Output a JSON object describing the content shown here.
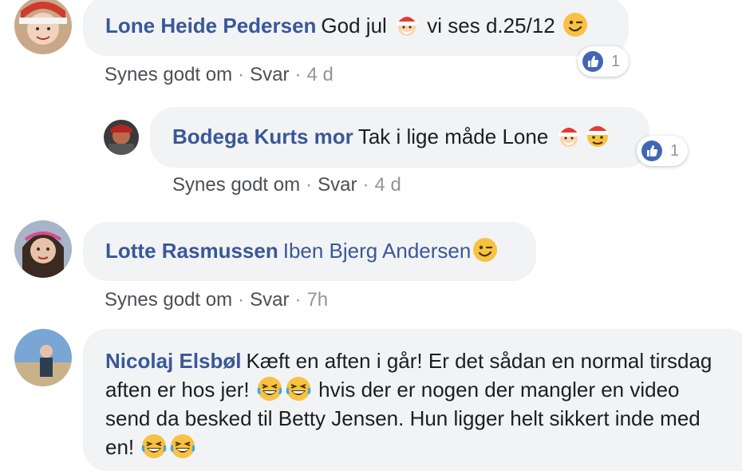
{
  "comments": [
    {
      "author": "Lone Heide Pedersen",
      "text_parts": [
        "God jul",
        "vi ses d.25/12"
      ],
      "emoji": [
        "santa-emoji",
        "wink-emoji"
      ],
      "actions": {
        "like": "Synes godt om",
        "sep": "·",
        "reply": "Svar",
        "time": "4 d"
      },
      "reaction_count": "1"
    },
    {
      "author": "Bodega Kurts mor",
      "text": "Tak i lige måde Lone",
      "emoji": [
        "santa-emoji",
        "santa-face-emoji"
      ],
      "actions": {
        "like": "Synes godt om",
        "sep": "·",
        "reply": "Svar",
        "time": "4 d"
      },
      "reaction_count": "1"
    },
    {
      "author": "Lotte Rasmussen",
      "tag": "Iben Bjerg Andersen",
      "emoji": [
        "wink-emoji"
      ],
      "actions": {
        "like": "Synes godt om",
        "sep": "·",
        "reply": "Svar",
        "time": "7h"
      }
    },
    {
      "author": "Nicolaj Elsbøl",
      "text_parts": [
        "Kæft en aften i går! Er det sådan en normal tirsdag",
        "aften er hos jer!",
        "hvis der er nogen der mangler en video",
        "send da besked til Betty Jensen. Hun ligger helt sikkert inde med",
        "en!"
      ],
      "emoji": [
        "laughing-emoji"
      ]
    }
  ],
  "colors": {
    "bubble": "#f2f3f5",
    "author": "#385898",
    "meta": "#90949c",
    "like_badge": "#4267b2"
  }
}
